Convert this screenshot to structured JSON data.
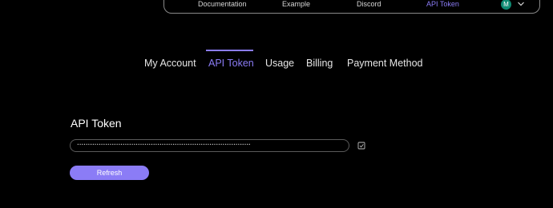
{
  "topnav": {
    "links": [
      "Documentation",
      "Example",
      "Discord",
      "API Token"
    ],
    "active_link": "API Token",
    "avatar_initial": "M"
  },
  "tabs": {
    "items": [
      "My Account",
      "API Token",
      "Usage",
      "Billing",
      "Payment Method"
    ],
    "active": "API Token"
  },
  "api_token": {
    "title": "API Token",
    "masked_value": "••••••••••••••••••••••••••••••••••••••••••••••••••••••••••••••••••••••••••••••••",
    "refresh_label": "Refresh"
  },
  "colors": {
    "background": "#000000",
    "accent": "#8b7cf6",
    "avatar": "#0f8a72"
  }
}
